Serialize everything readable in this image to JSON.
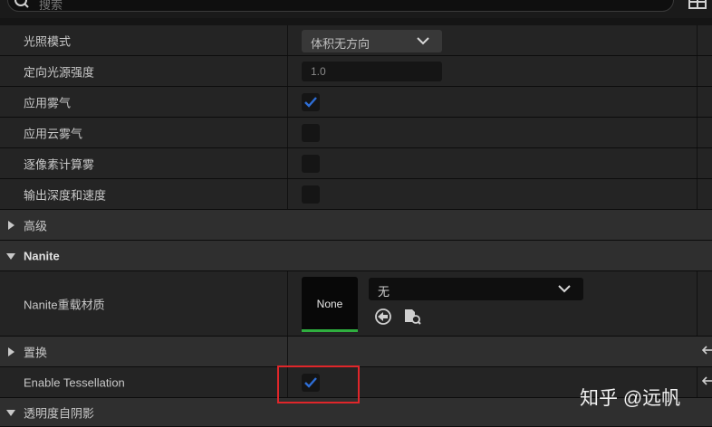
{
  "search": {
    "placeholder": "搜索"
  },
  "rows": {
    "lighting_mode": {
      "label": "光照模式",
      "value": "体积无方向"
    },
    "directional_intensity": {
      "label": "定向光源强度",
      "value": "1.0"
    },
    "apply_fog": {
      "label": "应用雾气",
      "checked": true
    },
    "apply_cloud_fog": {
      "label": "应用云雾气",
      "checked": false
    },
    "per_pixel_fog": {
      "label": "逐像素计算雾",
      "checked": false
    },
    "output_depth_velocity": {
      "label": "输出深度和速度",
      "checked": false
    }
  },
  "sections": {
    "advanced": {
      "label": "高级",
      "expanded": false
    },
    "nanite": {
      "label": "Nanite",
      "expanded": true
    },
    "displacement": {
      "label": "置换",
      "expanded": false
    },
    "translucency_shadow": {
      "label": "透明度自阴影",
      "expanded": true
    }
  },
  "nanite_override": {
    "label": "Nanite重载材质",
    "thumbnail_text": "None",
    "dropdown_value": "无"
  },
  "tessellation": {
    "label": "Enable Tessellation",
    "checked": true
  },
  "watermark": "知乎 @远帆",
  "colors": {
    "accent_check": "#2e6ed6",
    "highlight_box": "#e0262a",
    "thumbnail_bar": "#2fae3f"
  }
}
